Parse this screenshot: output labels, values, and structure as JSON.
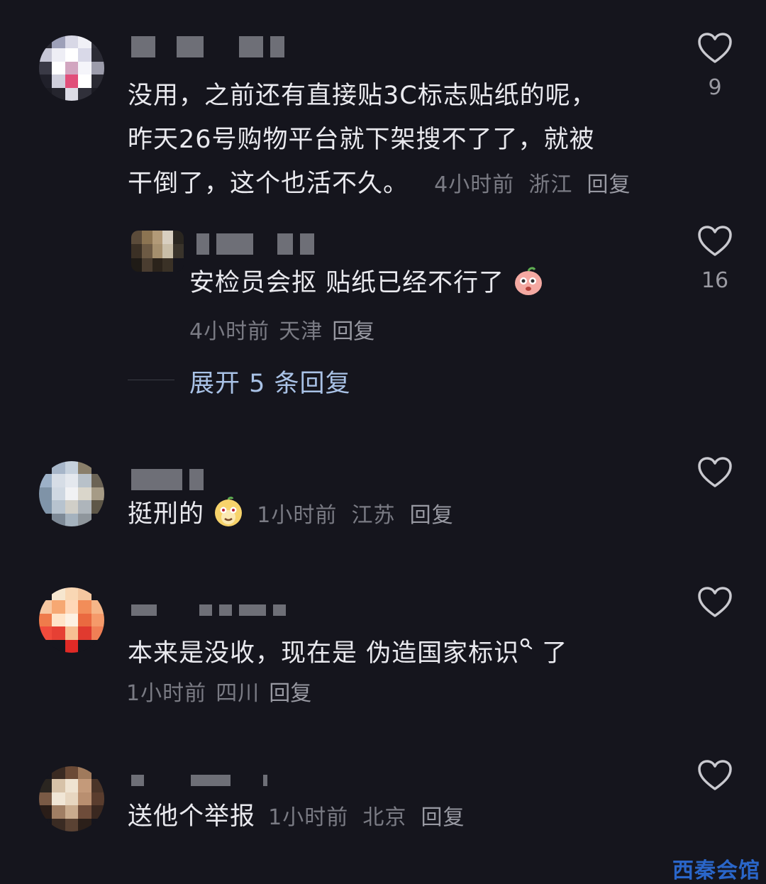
{
  "comments": [
    {
      "text_lines": [
        "没用，之前还有直接贴3C标志贴纸的呢，",
        "昨天26号购物平台就下架搜不了了，就被",
        "干倒了，这个也活不久。"
      ],
      "time": "4小时前",
      "location": "浙江",
      "reply_label": "回复",
      "likes": "9",
      "avatar_colors": [
        "#2a2a33",
        "#9da0b8",
        "#d8d8e6",
        "#f0f0f6",
        "#30303a",
        "#c7c7d6",
        "#eeeef5",
        "#ffffff",
        "#d9d9e8",
        "#2b2b35",
        "#3a3a46",
        "#ffffff",
        "#d2a6c0",
        "#f5f5fa",
        "#9c9cab",
        "#20202a",
        "#cfcfdc",
        "#e14f7a",
        "#ffffff",
        "#2a2a33",
        "#1b1b23",
        "#25252e",
        "#dcdce6",
        "#30303a",
        "#1b1b23"
      ]
    },
    {
      "text": "安检员会抠 贴纸已经不行了",
      "emoji": "flushed-peach-emoji",
      "time": "4小时前",
      "location": "天津",
      "reply_label": "回复",
      "likes": "16",
      "avatar_colors": [
        "#5b4b3a",
        "#8c7452",
        "#b29a78",
        "#d8cfc0",
        "#2a2620",
        "#3b3025",
        "#6d5a44",
        "#a58f6e",
        "#c9bea8",
        "#3a342b",
        "#1f1b16",
        "#4a3d30",
        "#2b231b",
        "#3a3126",
        "#15151d"
      ]
    }
  ],
  "expand_replies": "展开 5 条回复",
  "comments2": [
    {
      "text": "挺刑的",
      "emoji": "smug-face-emoji",
      "time": "1小时前",
      "location": "江苏",
      "reply_label": "回复",
      "avatar_colors": [
        "#15151d",
        "#a7b6c9",
        "#c6d1dd",
        "#8a7f6a",
        "#15151d",
        "#9db1c8",
        "#d6dde6",
        "#e4e8ee",
        "#b8c1c9",
        "#6b6355",
        "#7f93a7",
        "#cfd8e2",
        "#f1f2f4",
        "#dad6cb",
        "#a69b86",
        "#8095aa",
        "#b7c3cf",
        "#d1cfc8",
        "#aeb5bb",
        "#5e5748",
        "#15151d",
        "#7e8a97",
        "#a5b2be",
        "#8f969c",
        "#15151d"
      ]
    },
    {
      "text": "本来是没收，现在是 伪造国家标识",
      "search_mark": "search-icon",
      "text_tail": " 了",
      "time": "1小时前",
      "location": "四川",
      "reply_label": "回复",
      "avatar_colors": [
        "#15151d",
        "#f6e6cf",
        "#f9d7b4",
        "#f4c7a0",
        "#15151d",
        "#f7c8a2",
        "#f6a873",
        "#ffd8b8",
        "#f28d59",
        "#f6b688",
        "#ef7b4b",
        "#ffe4c8",
        "#fdf1e2",
        "#ea6a40",
        "#f59a6a",
        "#f04b3c",
        "#e64034",
        "#f7c093",
        "#e03a2f",
        "#f07f55",
        "#15151d",
        "#15151d",
        "#e02a26",
        "#15151d",
        "#15151d"
      ]
    },
    {
      "text": "送他个举报",
      "time": "1小时前",
      "location": "北京",
      "reply_label": "回复",
      "avatar_colors": [
        "#15151d",
        "#3a2a22",
        "#6b4a36",
        "#a07a5c",
        "#15151d",
        "#2a2520",
        "#d7c2a8",
        "#efe3d1",
        "#c49a7a",
        "#4a3428",
        "#7a5a45",
        "#f1e6d6",
        "#e7d6c0",
        "#b98f70",
        "#5a3d2e",
        "#2a1d18",
        "#a07e64",
        "#c9ab8e",
        "#6e4c3a",
        "#3a2820",
        "#15151d",
        "#3a2b23",
        "#5a4233",
        "#2b1f19",
        "#15151d"
      ]
    }
  ],
  "watermark": "西秦会馆"
}
